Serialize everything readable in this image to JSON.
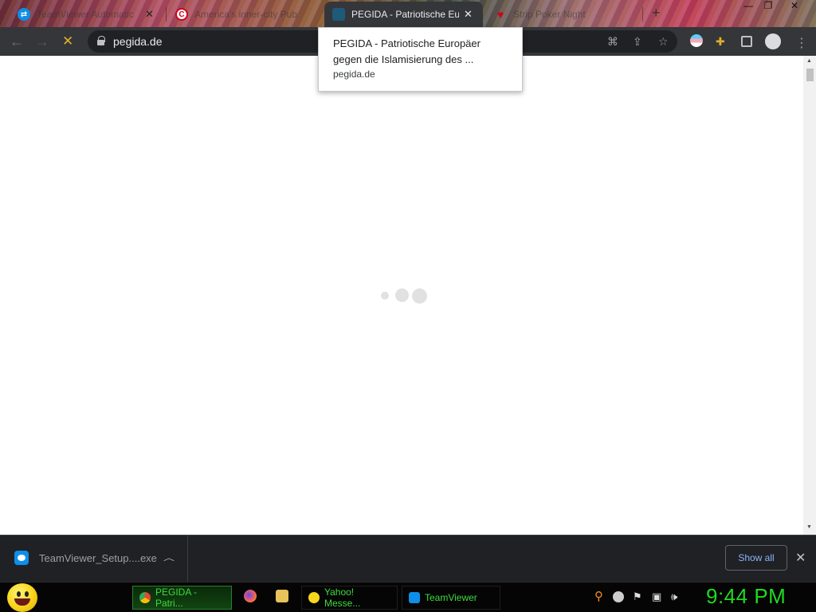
{
  "tabs": [
    {
      "title": "TeamViewer Automatic",
      "icon": "teamviewer-icon",
      "active": false
    },
    {
      "title": "America's inner-city Pub",
      "icon": "c-logo-icon",
      "active": false
    },
    {
      "title": "PEGIDA - Patriotische Eur",
      "icon": "pegida-favicon",
      "active": true
    },
    {
      "title": "Strip Poker Night",
      "icon": "heart-icon",
      "active": false
    }
  ],
  "toolbar": {
    "url": "pegida.de"
  },
  "tooltip": {
    "title": "PEGIDA - Patriotische Europäer gegen die Islamisierung des ...",
    "domain": "pegida.de"
  },
  "downloads": {
    "file_name": "TeamViewer_Setup....exe",
    "show_all_label": "Show all"
  },
  "taskbar": {
    "tasks": [
      {
        "label": "PEGIDA - Patri...",
        "icon": "chrome-icon",
        "active": true
      },
      {
        "label": "Yahoo! Messe...",
        "icon": "yahoo-messenger-icon",
        "active": false
      },
      {
        "label": "TeamViewer",
        "icon": "teamviewer-icon",
        "active": false
      }
    ],
    "clock": "9:44 PM"
  },
  "colors": {
    "toolbar_bg": "#35363a",
    "omnibox_bg": "#202124",
    "download_bar_bg": "#202124",
    "link_blue": "#8ab4f8",
    "clock_green": "#1fdb1f",
    "taskbar_text_green": "#3ddc3d"
  }
}
